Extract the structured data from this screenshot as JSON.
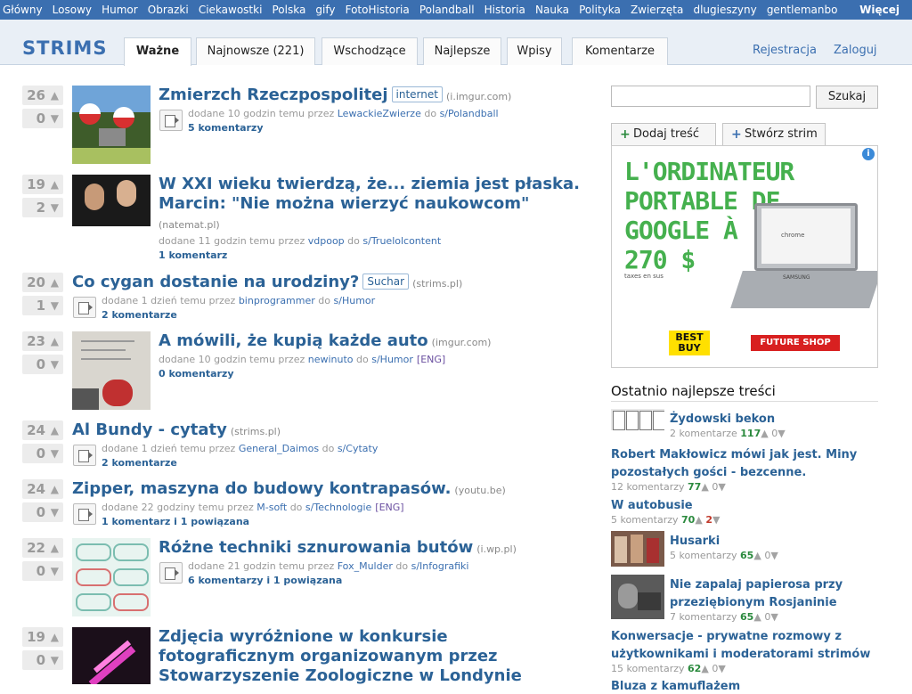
{
  "categories": [
    "Główny",
    "Losowy",
    "Humor",
    "Obrazki",
    "Ciekawostki",
    "Polska",
    "gify",
    "FotoHistoria",
    "Polandball",
    "Historia",
    "Nauka",
    "Polityka",
    "Zwierzęta",
    "dlugieszyny",
    "gentlemanbo"
  ],
  "more_label": "Więcej",
  "logo": "STRIMS",
  "tabs": [
    "Ważne",
    "Najnowsze (221)",
    "Wschodzące",
    "Najlepsze",
    "Wpisy",
    "Komentarze"
  ],
  "auth": {
    "register": "Rejestracja",
    "login": "Zaloguj"
  },
  "items": [
    {
      "up": "26",
      "down": "0",
      "title": "Zmierzch Rzeczpospolitej",
      "tag": "internet",
      "domain": "(i.imgur.com)",
      "meta_pre": "dodane 10 godzin temu przez",
      "user": "LewackieZwierze",
      "meta_mid": "do",
      "strim": "s/Polandball",
      "eng": "",
      "comments": "5 komentarzy"
    },
    {
      "up": "19",
      "down": "2",
      "title": "W XXI wieku twierdzą, że... ziemia jest płaska. Marcin: \"Nie można wierzyć naukowcom\"",
      "tag": "",
      "domain": "(natemat.pl)",
      "meta_pre": "dodane 11 godzin temu przez",
      "user": "vdpoop",
      "meta_mid": "do",
      "strim": "s/Truelolcontent",
      "eng": "",
      "comments": "1 komentarz"
    },
    {
      "up": "20",
      "down": "1",
      "title": "Co cygan dostanie na urodziny?",
      "tag": "Suchar",
      "domain": "(strims.pl)",
      "meta_pre": "dodane 1 dzień temu przez",
      "user": "binprogrammer",
      "meta_mid": "do",
      "strim": "s/Humor",
      "eng": "",
      "comments": "2 komentarze"
    },
    {
      "up": "23",
      "down": "0",
      "title": "A mówili, że kupią każde auto",
      "tag": "",
      "domain": "(imgur.com)",
      "meta_pre": "dodane 10 godzin temu przez",
      "user": "newinuto",
      "meta_mid": "do",
      "strim": "s/Humor",
      "eng": "[ENG]",
      "comments": "0 komentarzy"
    },
    {
      "up": "24",
      "down": "0",
      "title": "Al Bundy - cytaty",
      "tag": "",
      "domain": "(strims.pl)",
      "meta_pre": "dodane 1 dzień temu przez",
      "user": "General_Daimos",
      "meta_mid": "do",
      "strim": "s/Cytaty",
      "eng": "",
      "comments": "2 komentarze"
    },
    {
      "up": "24",
      "down": "0",
      "title": "Zipper, maszyna do budowy kontrapasów.",
      "tag": "",
      "domain": "(youtu.be)",
      "meta_pre": "dodane 22 godziny temu przez",
      "user": "M-soft",
      "meta_mid": "do",
      "strim": "s/Technologie",
      "eng": "[ENG]",
      "comments": "1 komentarz i 1 powiązana"
    },
    {
      "up": "22",
      "down": "0",
      "title": "Różne techniki sznurowania butów",
      "tag": "",
      "domain": "(i.wp.pl)",
      "meta_pre": "dodane 21 godzin temu przez",
      "user": "Fox_Mulder",
      "meta_mid": "do",
      "strim": "s/Infografiki",
      "eng": "",
      "comments": "6 komentarzy i 1 powiązana"
    },
    {
      "up": "19",
      "down": "0",
      "title": "Zdjęcia wyróżnione w konkursie fotograficznym organizowanym przez Stowarzyszenie Zoologiczne w Londynie",
      "tag": "",
      "domain": "",
      "meta_pre": "",
      "user": "",
      "meta_mid": "",
      "strim": "",
      "eng": "",
      "comments": ""
    }
  ],
  "search": {
    "button": "Szukaj"
  },
  "side_buttons": {
    "add": "Dodaj treść",
    "create": "Stwórz strim"
  },
  "ad": {
    "headline": "L'ORDINATEUR PORTABLE DE GOOGLE À 270 $",
    "small": "taxes en sus",
    "bestbuy": "BEST BUY",
    "futureshop": "FUTURE SHOP",
    "chrome": "chrome",
    "brand": "SAMSUNG"
  },
  "sidebar_heading": "Ostatnio najlepsze treści",
  "best": [
    {
      "title": "Żydowski bekon",
      "comments": "2 komentarze",
      "score": "117",
      "neg": "0"
    },
    {
      "title": "Robert Makłowicz mówi jak jest. Miny pozostałych gości - bezcenne.",
      "comments": "12 komentarzy",
      "score": "77",
      "neg": "0"
    },
    {
      "title": "W autobusie",
      "comments": "5 komentarzy",
      "score": "70",
      "neg": "2"
    },
    {
      "title": "Husarki",
      "comments": "5 komentarzy",
      "score": "65",
      "neg": "0"
    },
    {
      "title": "Nie zapalaj papierosa przy przeziębionym Rosjaninie",
      "comments": "7 komentarzy",
      "score": "65",
      "neg": "0"
    },
    {
      "title": "Konwersacje - prywatne rozmowy z użytkownikami i moderatorami strimów",
      "comments": "15 komentarzy",
      "score": "62",
      "neg": "0"
    },
    {
      "title": "Bluza z kamuflażem",
      "comments": "",
      "score": "",
      "neg": ""
    }
  ],
  "colors": {
    "brand_blue": "#3b6fb0",
    "link": "#2b6296",
    "positive": "#2b8a3e",
    "negative": "#c0392b",
    "ad_green": "#45b04e"
  }
}
